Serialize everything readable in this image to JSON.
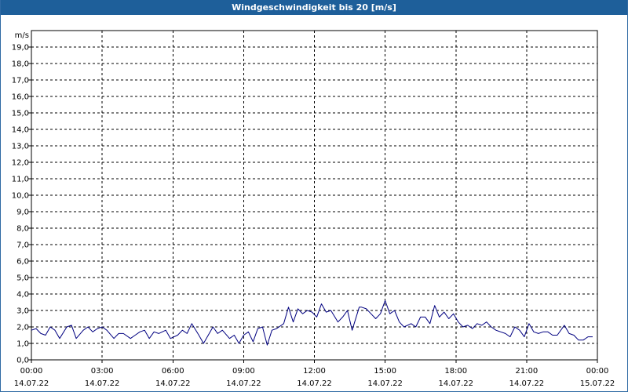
{
  "window": {
    "title": "Windgeschwindigkeit bis 20 [m/s]",
    "title_bg": "#1e5f9a",
    "title_color": "#ffffff"
  },
  "chart_data": {
    "type": "line",
    "title": "Windgeschwindigkeit bis 20 [m/s]",
    "ylabel": "m/s",
    "xlabel": "",
    "ylim": [
      0,
      20
    ],
    "y_ticks": [
      "0,0",
      "1,0",
      "2,0",
      "3,0",
      "4,0",
      "5,0",
      "6,0",
      "7,0",
      "8,0",
      "9,0",
      "10,0",
      "11,0",
      "12,0",
      "13,0",
      "14,0",
      "15,0",
      "16,0",
      "17,0",
      "18,0",
      "19,0"
    ],
    "x_range_hours": [
      0,
      24
    ],
    "x_ticks": [
      {
        "time": "00:00",
        "date": "14.07.22"
      },
      {
        "time": "03:00",
        "date": "14.07.22"
      },
      {
        "time": "06:00",
        "date": "14.07.22"
      },
      {
        "time": "09:00",
        "date": "14.07.22"
      },
      {
        "time": "12:00",
        "date": "14.07.22"
      },
      {
        "time": "15:00",
        "date": "14.07.22"
      },
      {
        "time": "18:00",
        "date": "14.07.22"
      },
      {
        "time": "21:00",
        "date": "14.07.22"
      },
      {
        "time": "00:00",
        "date": "15.07.22"
      }
    ],
    "grid": true,
    "grid_style": "dashed",
    "line_color": "#000080",
    "series": [
      {
        "x": [
          0.0,
          0.2,
          0.4,
          0.6,
          0.8,
          1.0,
          1.2,
          1.5,
          1.7,
          1.9,
          2.2,
          2.4,
          2.6,
          2.8,
          3.0,
          3.2,
          3.5,
          3.7,
          3.9,
          4.2,
          4.4,
          4.6,
          4.8,
          5.0,
          5.2,
          5.4,
          5.7,
          5.9,
          6.2,
          6.4,
          6.6,
          6.8,
          7.1,
          7.3,
          7.5,
          7.7,
          7.9,
          8.1,
          8.4,
          8.6,
          8.8,
          9.0,
          9.2,
          9.4,
          9.6,
          9.8,
          10.0,
          10.2,
          10.4,
          10.7,
          10.9,
          11.1,
          11.3,
          11.5,
          11.7,
          11.9,
          12.1,
          12.3,
          12.5,
          12.7,
          13.0,
          13.2,
          13.4,
          13.6,
          13.9,
          14.0,
          14.2,
          14.4,
          14.6,
          14.8,
          15.0,
          15.2,
          15.4,
          15.6,
          15.8,
          16.1,
          16.3,
          16.5,
          16.7,
          16.9,
          17.1,
          17.3,
          17.5,
          17.7,
          17.9,
          18.1,
          18.3,
          18.5,
          18.7,
          18.9,
          19.1,
          19.3,
          19.5,
          19.7,
          19.9,
          20.1,
          20.3,
          20.5,
          20.7,
          20.9,
          21.1,
          21.3,
          21.5,
          21.7,
          21.9,
          22.1,
          22.3,
          22.6,
          22.8,
          23.0,
          23.2,
          23.4,
          23.6,
          23.8
        ],
        "y": [
          1.8,
          1.9,
          1.6,
          1.5,
          2.0,
          1.8,
          1.3,
          2.0,
          2.1,
          1.3,
          1.8,
          2.0,
          1.7,
          1.9,
          2.0,
          1.8,
          1.3,
          1.6,
          1.6,
          1.3,
          1.5,
          1.7,
          1.8,
          1.3,
          1.7,
          1.6,
          1.8,
          1.3,
          1.5,
          1.8,
          1.6,
          2.2,
          1.5,
          1.0,
          1.5,
          2.0,
          1.6,
          1.8,
          1.3,
          1.5,
          1.0,
          1.5,
          1.7,
          1.1,
          1.9,
          2.0,
          0.9,
          1.8,
          1.9,
          2.2,
          3.2,
          2.3,
          3.1,
          2.8,
          3.0,
          2.9,
          2.6,
          3.4,
          2.9,
          3.0,
          2.3,
          2.6,
          3.0,
          1.8,
          3.2,
          3.2,
          3.1,
          2.8,
          2.5,
          2.8,
          3.6,
          2.8,
          3.0,
          2.3,
          2.0,
          2.2,
          2.0,
          2.6,
          2.6,
          2.2,
          3.3,
          2.6,
          2.9,
          2.5,
          2.8,
          2.3,
          2.0,
          2.1,
          1.9,
          2.2,
          2.1,
          2.3,
          2.0,
          1.8,
          1.7,
          1.6,
          1.4,
          2.0,
          1.8,
          1.4,
          2.2,
          1.7,
          1.6,
          1.7,
          1.7,
          1.5,
          1.5,
          2.1,
          1.6,
          1.5,
          1.2,
          1.2,
          1.4,
          1.4
        ]
      }
    ]
  }
}
